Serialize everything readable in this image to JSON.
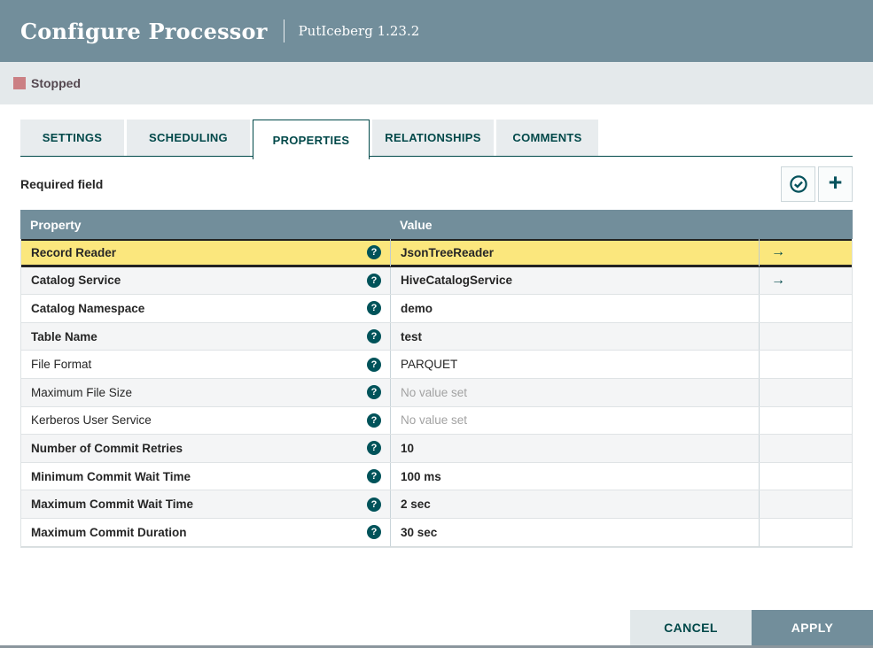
{
  "dialog": {
    "title": "Configure Processor",
    "subtitle": "PutIceberg 1.23.2",
    "status": {
      "label": "Stopped",
      "icon": "stop-square-icon",
      "icon_color": "#CB8084"
    },
    "tabs": [
      {
        "label": "SETTINGS",
        "active": false
      },
      {
        "label": "SCHEDULING",
        "active": false
      },
      {
        "label": "PROPERTIES",
        "active": true
      },
      {
        "label": "RELATIONSHIPS",
        "active": false
      },
      {
        "label": "COMMENTS",
        "active": false
      }
    ],
    "properties_panel": {
      "required_field_label": "Required field",
      "toolbar": {
        "verify_button_icon": "check-circle-icon",
        "add_button_icon": "plus-icon"
      },
      "table": {
        "columns": [
          "Property",
          "Value"
        ],
        "help_icon_glyph": "?",
        "goto_icon_glyph": "→",
        "rows": [
          {
            "property": "Record Reader",
            "value": "JsonTreeReader",
            "required": true,
            "selected": true,
            "has_goto": true,
            "value_set": true
          },
          {
            "property": "Catalog Service",
            "value": "HiveCatalogService",
            "required": true,
            "selected": false,
            "has_goto": true,
            "value_set": true
          },
          {
            "property": "Catalog Namespace",
            "value": "demo",
            "required": true,
            "selected": false,
            "has_goto": false,
            "value_set": true
          },
          {
            "property": "Table Name",
            "value": "test",
            "required": true,
            "selected": false,
            "has_goto": false,
            "value_set": true
          },
          {
            "property": "File Format",
            "value": "PARQUET",
            "required": false,
            "selected": false,
            "has_goto": false,
            "value_set": true
          },
          {
            "property": "Maximum File Size",
            "value": "No value set",
            "required": false,
            "selected": false,
            "has_goto": false,
            "value_set": false
          },
          {
            "property": "Kerberos User Service",
            "value": "No value set",
            "required": false,
            "selected": false,
            "has_goto": false,
            "value_set": false
          },
          {
            "property": "Number of Commit Retries",
            "value": "10",
            "required": true,
            "selected": false,
            "has_goto": false,
            "value_set": true
          },
          {
            "property": "Minimum Commit Wait Time",
            "value": "100 ms",
            "required": true,
            "selected": false,
            "has_goto": false,
            "value_set": true
          },
          {
            "property": "Maximum Commit Wait Time",
            "value": "2 sec",
            "required": true,
            "selected": false,
            "has_goto": false,
            "value_set": true
          },
          {
            "property": "Maximum Commit Duration",
            "value": "30 sec",
            "required": true,
            "selected": false,
            "has_goto": false,
            "value_set": true
          }
        ]
      }
    },
    "footer": {
      "cancel_label": "CANCEL",
      "apply_label": "APPLY"
    },
    "colors": {
      "header_bg": "#728E9B",
      "accent_teal": "#004849",
      "status_bar_bg": "#E4E9EB",
      "selected_row_bg": "#FBE77D",
      "table_header_bg": "#728E9B",
      "stopped_icon": "#CB8084"
    }
  }
}
